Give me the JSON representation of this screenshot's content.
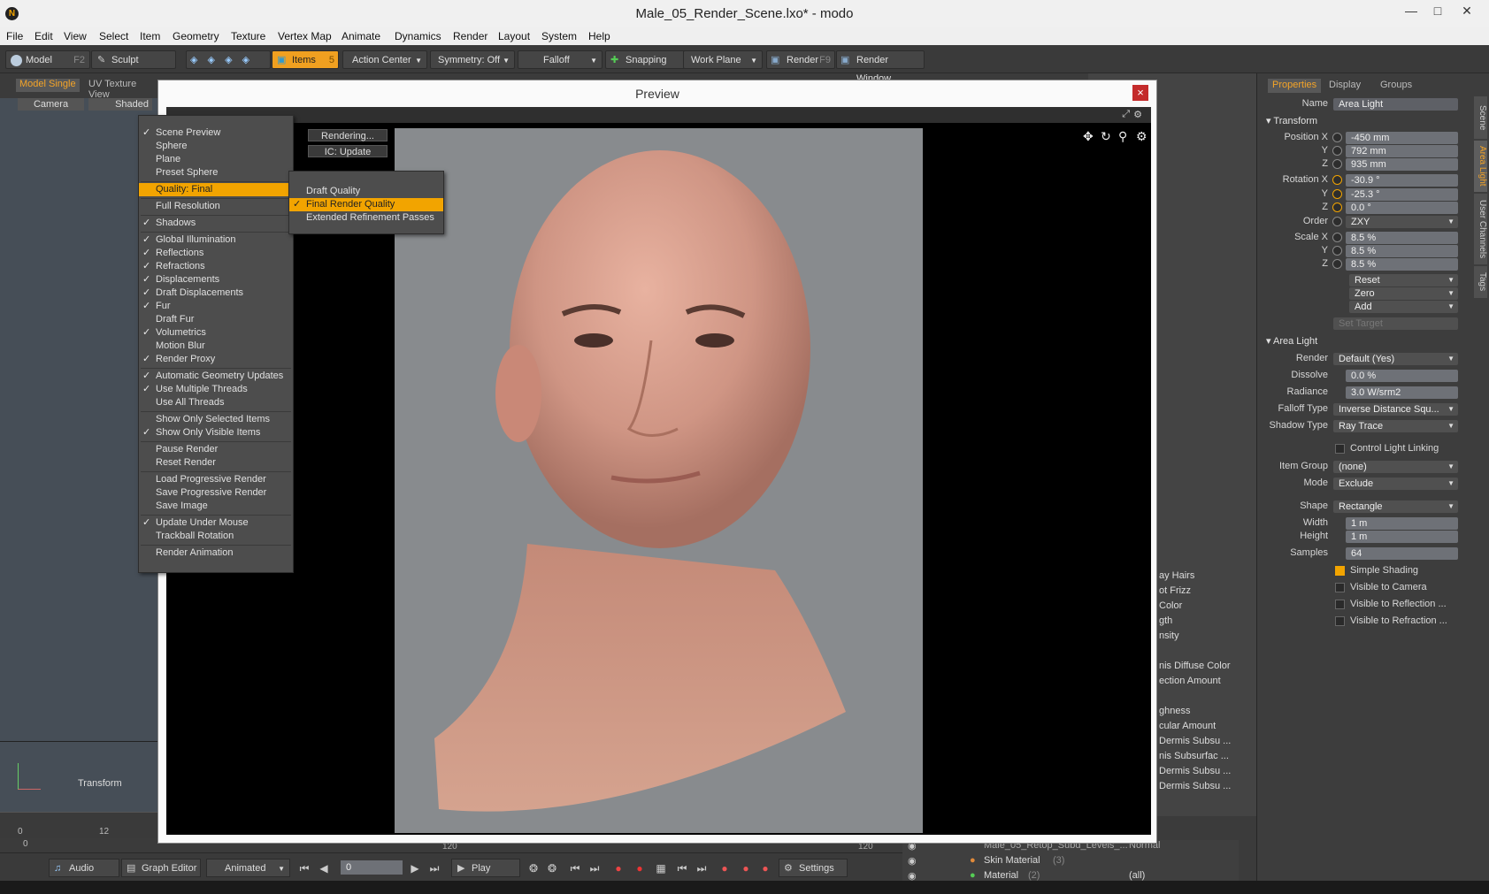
{
  "window": {
    "title": "Male_05_Render_Scene.lxo* - modo"
  },
  "menubar": [
    "File",
    "Edit",
    "View",
    "Select",
    "Item",
    "Geometry",
    "Texture",
    "Vertex Map",
    "Animate",
    "Dynamics",
    "Render",
    "Layout",
    "System",
    "Help"
  ],
  "toolbar": {
    "model": "Model",
    "model_key": "F2",
    "sculpt": "Sculpt",
    "items": "Items",
    "items_key": "5",
    "action_center": "Action Center",
    "symmetry": "Symmetry: Off",
    "falloff": "Falloff",
    "snapping": "Snapping",
    "work_plane": "Work Plane",
    "render": "Render",
    "render_key": "F9",
    "render_window": "Render Window"
  },
  "viewport": {
    "tab_model": "Model Single",
    "tab_uv": "UV Texture View",
    "camera": "Camera",
    "shaded": "Shaded",
    "transform": "Transform",
    "ruler": [
      "0",
      "12"
    ],
    "ruler2": "0"
  },
  "preview": {
    "title": "Preview",
    "close": "×",
    "status_rendering": "Rendering...",
    "status_ic": "IC: Update"
  },
  "preview_menu": [
    {
      "label": "Scene Preview",
      "checked": true
    },
    {
      "label": "Sphere",
      "checked": false
    },
    {
      "label": "Plane",
      "checked": false
    },
    {
      "label": "Preset Sphere",
      "checked": false
    },
    {
      "label": "Quality: Final",
      "checked": false,
      "highlight": true
    },
    {
      "label": "Full Resolution",
      "checked": false
    },
    {
      "label": "Shadows",
      "checked": true
    },
    {
      "label": "Global Illumination",
      "checked": true
    },
    {
      "label": "Reflections",
      "checked": true
    },
    {
      "label": "Refractions",
      "checked": true
    },
    {
      "label": "Displacements",
      "checked": true
    },
    {
      "label": "Draft Displacements",
      "checked": true
    },
    {
      "label": "Fur",
      "checked": true
    },
    {
      "label": "Draft Fur",
      "checked": false
    },
    {
      "label": "Volumetrics",
      "checked": true
    },
    {
      "label": "Motion Blur",
      "checked": false
    },
    {
      "label": "Render Proxy",
      "checked": true
    },
    {
      "label": "Automatic Geometry Updates",
      "checked": true
    },
    {
      "label": "Use Multiple Threads",
      "checked": true
    },
    {
      "label": "Use All Threads",
      "checked": false
    },
    {
      "label": "Show Only Selected Items",
      "checked": false
    },
    {
      "label": "Show Only Visible Items",
      "checked": true
    },
    {
      "label": "Pause Render",
      "checked": false
    },
    {
      "label": "Reset Render",
      "checked": false
    },
    {
      "label": "Load Progressive Render",
      "checked": false
    },
    {
      "label": "Save Progressive Render",
      "checked": false
    },
    {
      "label": "Save Image",
      "checked": false
    },
    {
      "label": "Update Under Mouse",
      "checked": true
    },
    {
      "label": "Trackball Rotation",
      "checked": false
    },
    {
      "label": "Render Animation",
      "checked": false
    }
  ],
  "quality_submenu": [
    {
      "label": "Draft Quality",
      "checked": false
    },
    {
      "label": "Final Render Quality",
      "checked": true,
      "highlight": true
    },
    {
      "label": "Extended Refinement Passes",
      "checked": false
    }
  ],
  "properties": {
    "tabs": [
      "Properties",
      "Display",
      "Groups"
    ],
    "side_tabs": [
      "Scene",
      "Area Light",
      "User Channels",
      "Tags"
    ],
    "name_label": "Name",
    "name_value": "Area Light",
    "transform_section": "Transform",
    "position_x_label": "Position X",
    "position_x": "-450 mm",
    "position_y_label": "Y",
    "position_y": "792 mm",
    "position_z_label": "Z",
    "position_z": "935 mm",
    "rotation_x_label": "Rotation X",
    "rotation_x": "-30.9 °",
    "rotation_y_label": "Y",
    "rotation_y": "-25.3 °",
    "rotation_z_label": "Z",
    "rotation_z": "0.0 °",
    "order_label": "Order",
    "order": "ZXY",
    "scale_x_label": "Scale X",
    "scale_x": "8.5 %",
    "scale_y_label": "Y",
    "scale_y": "8.5 %",
    "scale_z_label": "Z",
    "scale_z": "8.5 %",
    "reset": "Reset",
    "zero": "Zero",
    "add": "Add",
    "set_target": "Set Target",
    "area_light_section": "Area Light",
    "render_label": "Render",
    "render": "Default (Yes)",
    "dissolve_label": "Dissolve",
    "dissolve": "0.0 %",
    "radiance_label": "Radiance",
    "radiance": "3.0 W/srm2",
    "falloff_label": "Falloff Type",
    "falloff": "Inverse Distance Squ...",
    "shadow_label": "Shadow Type",
    "shadow": "Ray Trace",
    "control_linking": "Control Light Linking",
    "item_group_label": "Item Group",
    "item_group": "(none)",
    "mode_label": "Mode",
    "mode": "Exclude",
    "shape_label": "Shape",
    "shape": "Rectangle",
    "width_label": "Width",
    "width": "1 m",
    "height_label": "Height",
    "height": "1 m",
    "samples_label": "Samples",
    "samples": "64",
    "simple_shading": "Simple Shading",
    "visible_camera": "Visible to Camera",
    "visible_reflection": "Visible to Reflection ...",
    "visible_refraction": "Visible to Refraction ..."
  },
  "channel_list": [
    "ay Hairs",
    "ot Frizz",
    "Color",
    "gth",
    "nsity",
    "nis Diffuse Color",
    "ection Amount",
    "ghness",
    "cular Amount",
    "Dermis Subsu ...",
    "nis Subsurfac ...",
    "Dermis Subsu ...",
    "Dermis Subsu ..."
  ],
  "shader_tree": {
    "row1": "Male_05_Retop_Subd_Levels_...",
    "row1_val": "Normal",
    "row2": "Skin Material",
    "row2_count": "(3)",
    "row3": "Material",
    "row3_count": "(2)",
    "row3_val": "(all)"
  },
  "bottombar": {
    "audio": "Audio",
    "graph_editor": "Graph Editor",
    "animated": "Animated",
    "frame": "0",
    "play": "Play",
    "settings": "Settings",
    "timeline": [
      "120",
      "120"
    ]
  }
}
